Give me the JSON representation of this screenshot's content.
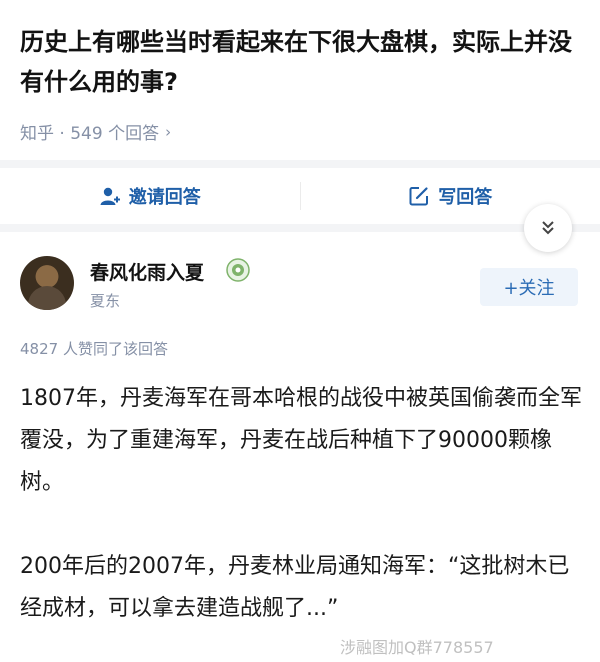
{
  "question": {
    "title": "历史上有哪些当时看起来在下很大盘棋，实际上并没有什么用的事?",
    "meta": "知乎 · 549 个回答",
    "meta_chevron": "›"
  },
  "actions": {
    "invite_label": "邀请回答",
    "write_label": "写回答"
  },
  "expand": {
    "icon": "double-chevron-down-icon"
  },
  "author": {
    "name": "春风化雨入夏",
    "bio": "夏东",
    "follow_label": "+关注",
    "badge_icon": "achievement-badge-icon"
  },
  "answer": {
    "upvote_text": "4827 人赞同了该回答",
    "paragraphs": [
      "1807年，丹麦海军在哥本哈根的战役中被英国偷袭而全军覆没，为了重建海军，丹麦在战后种植下了90000颗橡树。",
      "200年后的2007年，丹麦林业局通知海军：“这批树木已经成材，可以拿去建造战舰了...”"
    ]
  },
  "watermark": "涉融图加Q群778557"
}
